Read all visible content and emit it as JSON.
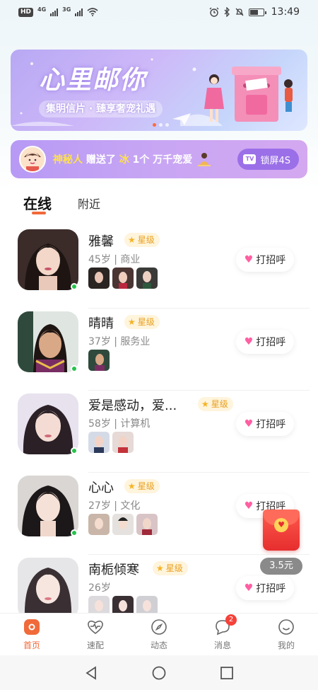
{
  "status_bar": {
    "left_badge": "HD",
    "network_1": "4G",
    "network_2": "3G",
    "time": "13:49"
  },
  "banner": {
    "title": "心里邮你",
    "subtitle": "集明信片 · 臻享奢宠礼遇",
    "page_count": 3,
    "active_page": 1
  },
  "gift_notice": {
    "sender": "神秘人",
    "action": "赠送了",
    "receiver": "冰",
    "gift": "1个 万千宠爱",
    "button_label": "锁屏4S"
  },
  "tabs": {
    "online": "在线",
    "nearby": "附近"
  },
  "list": [
    {
      "name": "雅馨",
      "level": "星级",
      "meta": "45岁 | 商业",
      "photos": 3,
      "greet": "打招呼"
    },
    {
      "name": "晴晴",
      "level": "星级",
      "meta": "37岁 | 服务业",
      "photos": 1,
      "greet": "打招呼"
    },
    {
      "name": "爱是感动，爱...",
      "level": "星级",
      "meta": "58岁 | 计算机",
      "photos": 2,
      "greet": "打招呼"
    },
    {
      "name": "心心",
      "level": "星级",
      "meta": "27岁 | 文化",
      "photos": 3,
      "greet": "打招呼"
    },
    {
      "name": "南栀倾寒",
      "level": "星级",
      "meta": "26岁",
      "photos": 3,
      "greet": "打招呼"
    }
  ],
  "red_packet": {
    "amount": "3.5元"
  },
  "bottom_nav": {
    "home": "首页",
    "match": "速配",
    "moments": "动态",
    "messages": "消息",
    "messages_badge": "2",
    "me": "我的"
  },
  "colors": {
    "accent": "#f06a3a",
    "online": "#27c24c",
    "badge": "#f5413a",
    "gold": "#e8a020"
  }
}
